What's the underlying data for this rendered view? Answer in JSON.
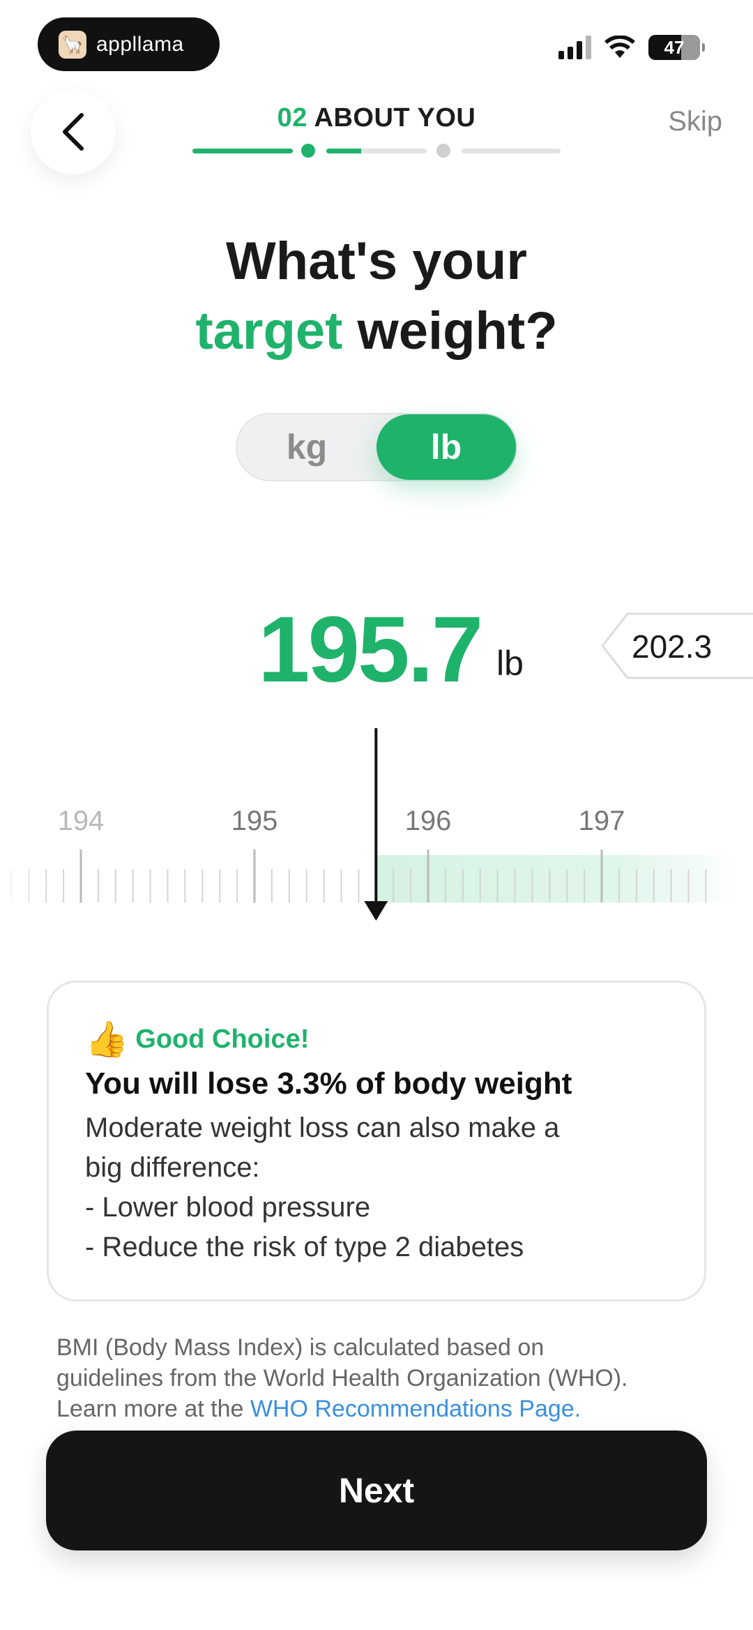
{
  "status_bar": {
    "app_badge": "appllama",
    "battery": "47"
  },
  "header": {
    "step_number": "02",
    "step_title": "ABOUT YOU",
    "skip_label": "Skip",
    "progress": [
      1.0,
      0.35,
      0.0
    ]
  },
  "question": {
    "line1": "What's your",
    "accent": "target",
    "line2_rest": " weight?"
  },
  "unit_toggle": {
    "options": [
      "kg",
      "lb"
    ],
    "selected": "lb"
  },
  "weight": {
    "target_value": "195.7",
    "unit": "lb",
    "current_value": "202.3"
  },
  "ruler": {
    "labels": [
      "194",
      "195",
      "196",
      "197"
    ],
    "target": 195.7,
    "current": 202.3
  },
  "card": {
    "icon": "thumbs-up-icon",
    "kicker": "Good Choice!",
    "title": "You will lose 3.3% of body weight",
    "body_line1": "Moderate weight loss can also make a",
    "body_line2": "big difference:",
    "bullet1": "- Lower blood pressure",
    "bullet2": "- Reduce the risk of type 2 diabetes"
  },
  "footer": {
    "bmi_line1": "BMI (Body Mass Index) is calculated based on",
    "bmi_line2": "guidelines from the World Health Organization (WHO).",
    "bmi_line3_prefix": "Learn more at the ",
    "bmi_link": "WHO Recommendations Page.",
    "next_label": "Next"
  },
  "colors": {
    "accent": "#1fb26b",
    "dark": "#151515",
    "link": "#3a8fe0"
  }
}
